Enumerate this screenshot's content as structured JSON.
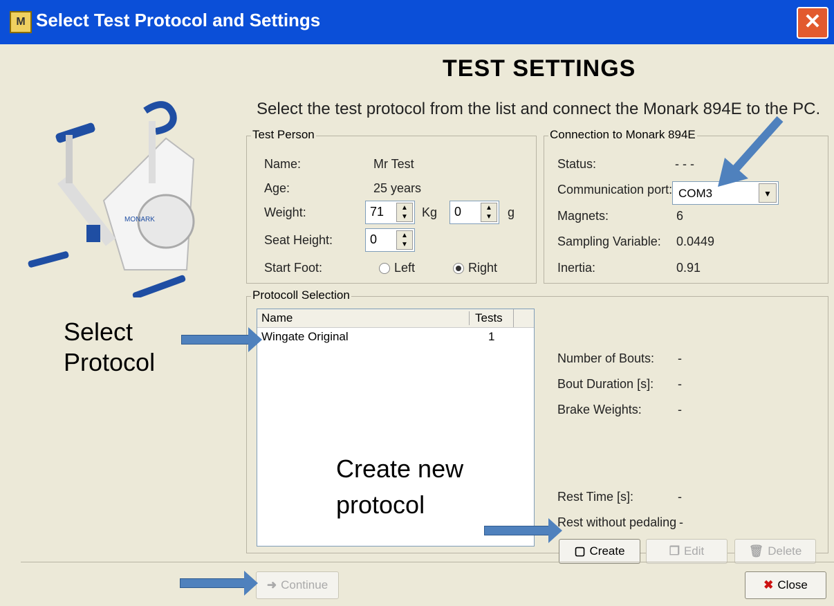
{
  "window": {
    "title": "Select Test Protocol and Settings",
    "close_glyph": "✕"
  },
  "header": {
    "heading": "TEST SETTINGS",
    "instruction": "Select the test protocol from the list and connect the Monark 894E to the PC."
  },
  "test_person": {
    "legend": "Test Person",
    "name_label": "Name:",
    "name_value": "Mr  Test",
    "age_label": "Age:",
    "age_value": "25 years",
    "weight_label": "Weight:",
    "weight_kg": "71",
    "weight_kg_unit": "Kg",
    "weight_g": "0",
    "weight_g_unit": "g",
    "seat_height_label": "Seat Height:",
    "seat_height_value": "0",
    "start_foot_label": "Start Foot:",
    "start_foot_left": "Left",
    "start_foot_right": "Right",
    "start_foot_selected": "Right"
  },
  "connection": {
    "legend": "Connection to Monark 894E",
    "status_label": "Status:",
    "status_value": "- - -",
    "port_label": "Communication port:",
    "port_value": "COM3",
    "magnets_label": "Magnets:",
    "magnets_value": "6",
    "sampling_label": "Sampling Variable:",
    "sampling_value": "0.0449",
    "inertia_label": "Inertia:",
    "inertia_value": "0.91"
  },
  "protocol_selection": {
    "legend": "Protocoll Selection",
    "columns": [
      "Name",
      "Tests"
    ],
    "rows": [
      {
        "name": "Wingate Original",
        "tests": "1"
      }
    ],
    "details": {
      "bouts_label": "Number of Bouts:",
      "bouts_value": "-",
      "duration_label": "Bout Duration [s]:",
      "duration_value": "-",
      "brake_label": "Brake Weights:",
      "brake_value": "-",
      "rest_label": "Rest Time [s]:",
      "rest_value": "-",
      "rest_no_pedal_label": "Rest without pedaling",
      "rest_no_pedal_value": "-"
    },
    "buttons": {
      "create": "Create",
      "edit": "Edit",
      "delete": "Delete"
    }
  },
  "footer": {
    "continue": "Continue",
    "close": "Close"
  },
  "annotations": {
    "select_protocol_line1": "Select",
    "select_protocol_line2": "Protocol",
    "create_new_line1": "Create new",
    "create_new_line2": "protocol"
  },
  "colors": {
    "titlebar": "#0b4fd8",
    "window_bg": "#ece9d8",
    "arrow": "#4f81bd"
  }
}
